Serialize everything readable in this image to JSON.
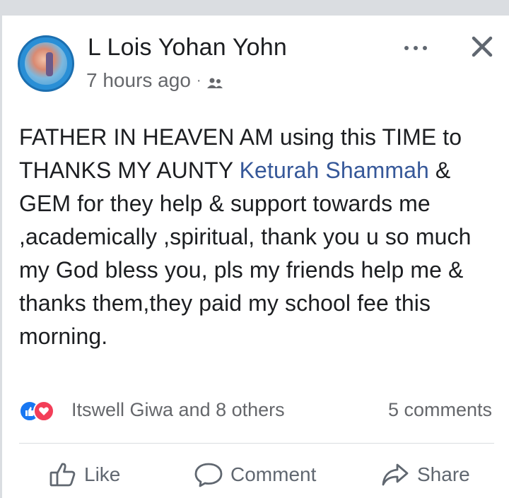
{
  "post": {
    "author": "L Lois Yohan Yohn",
    "time": "7 hours ago",
    "separator": "·",
    "audience_icon": "friends-icon",
    "body_part1": "FATHER IN HEAVEN AM using this TIME to THANKS MY AUNTY ",
    "mention": "Keturah Shammah",
    "body_part2": " & GEM for they help & support towards me ,academically ,spiritual, thank you u so much my God bless you, pls my friends help me & thanks them,they paid my school fee this morning."
  },
  "reactions": {
    "icons": [
      "like-reaction-icon",
      "love-reaction-icon"
    ],
    "names": "Itswell Giwa and 8 others",
    "comments": "5 comments"
  },
  "actions": {
    "like": "Like",
    "comment": "Comment",
    "share": "Share"
  },
  "colors": {
    "link": "#365899",
    "meta_text": "#65676b",
    "like_blue": "#1877f2",
    "love_red": "#f33e58"
  }
}
